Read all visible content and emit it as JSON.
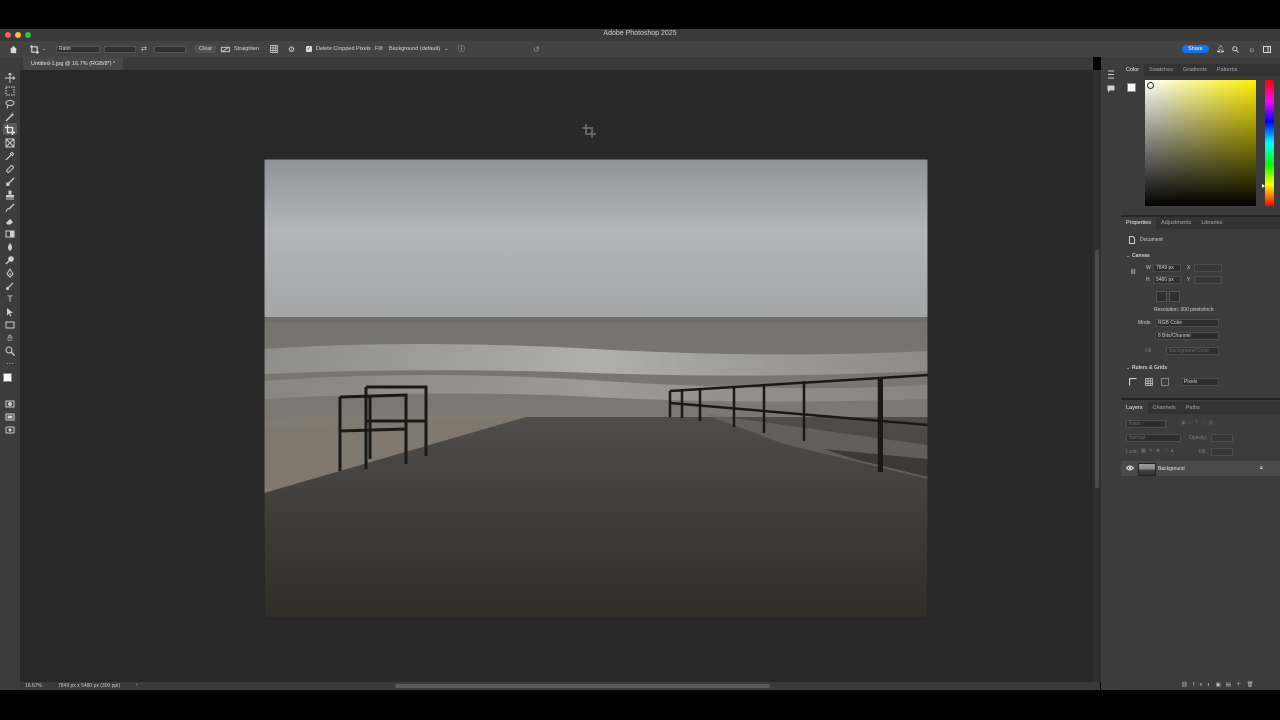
{
  "window": {
    "title": "Adobe Photoshop 2025"
  },
  "options_bar": {
    "ratio_label": "Ratio",
    "clear_label": "Clear",
    "straighten_label": "Straighten",
    "delete_cropped_label": "Delete Cropped Pixels",
    "delete_cropped_checked": true,
    "fill_label": "Fill:",
    "fill_value": "Background (default)",
    "share_label": "Share"
  },
  "document": {
    "tab_label": "Untitled-1.jpg @ 16.7% (RGB/8*) *"
  },
  "status_bar": {
    "zoom": "16.67%",
    "info": "7849 px x 5480 px (300 ppi)"
  },
  "color_panel": {
    "tabs": [
      "Color",
      "Swatches",
      "Gradients",
      "Patterns"
    ],
    "hue_color": "#fff000"
  },
  "properties_panel": {
    "tabs": [
      "Properties",
      "Adjustments",
      "Libraries"
    ],
    "document_label": "Document",
    "canvas_section": "Canvas",
    "w_label": "W",
    "w_value": "7849 px",
    "h_label": "H",
    "h_value": "5480 px",
    "x_label": "X",
    "y_label": "Y",
    "resolution": "Resolution: 300 pixels/inch",
    "mode_label": "Mode",
    "mode_value": "RGB Color",
    "bits_value": "8 Bits/Channel",
    "fill_label": "Fill",
    "fill_value": "Background Color",
    "rulers_section": "Rulers & Grids",
    "units_value": "Pixels"
  },
  "layers_panel": {
    "tabs": [
      "Layers",
      "Channels",
      "Paths"
    ],
    "kind_placeholder": "Kind",
    "blend_mode": "Normal",
    "opacity_label": "Opacity:",
    "lock_label": "Lock:",
    "fill_label": "Fill:",
    "layers": [
      {
        "name": "Background",
        "visible": true,
        "locked": true
      }
    ]
  },
  "colors": {
    "accent": "#1473e6",
    "canvas_bg": "#282828",
    "panel_bg": "#3c3c3c"
  }
}
